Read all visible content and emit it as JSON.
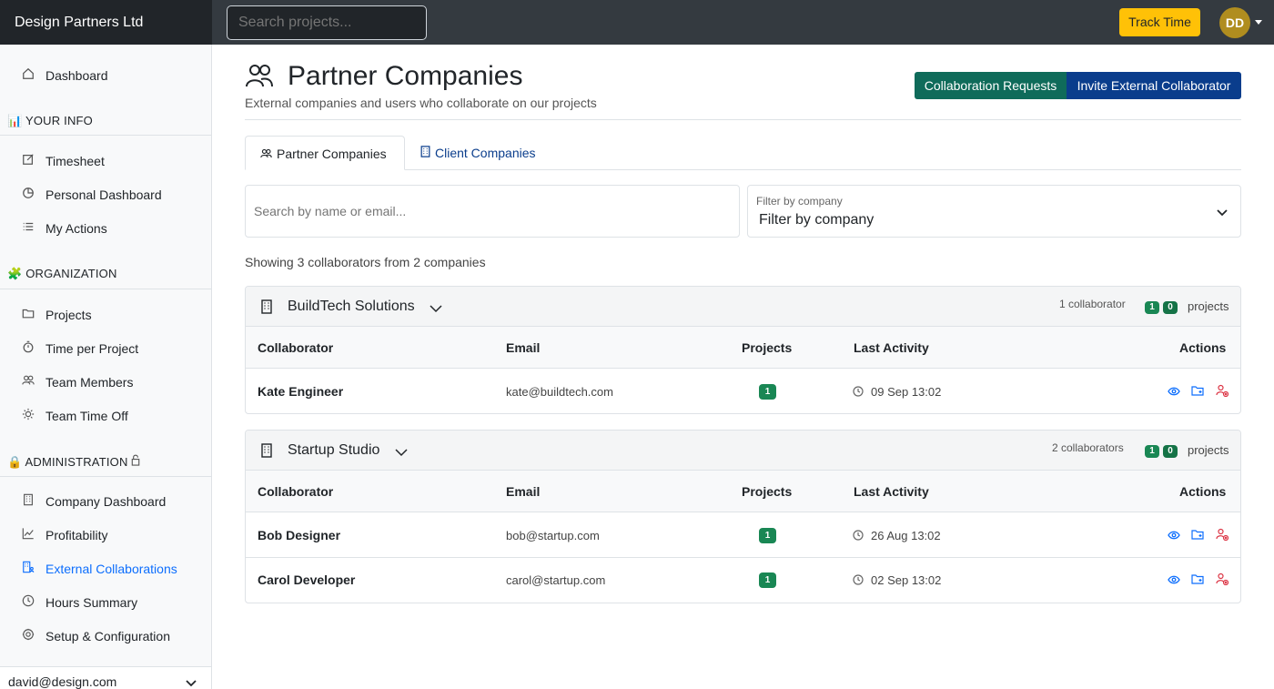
{
  "app": {
    "brand": "Design Partners Ltd",
    "search_placeholder": "Search projects...",
    "track_time": "Track Time",
    "avatar_initials": "DD"
  },
  "sidebar": {
    "dashboard": "Dashboard",
    "sections": {
      "your_info": "YOUR INFO",
      "organization": "ORGANIZATION",
      "administration": "ADMINISTRATION"
    },
    "your_info_items": [
      "Timesheet",
      "Personal Dashboard",
      "My Actions"
    ],
    "organization_items": [
      "Projects",
      "Time per Project",
      "Team Members",
      "Team Time Off"
    ],
    "administration_items": [
      "Company Dashboard",
      "Profitability",
      "External Collaborations",
      "Hours Summary",
      "Setup & Configuration"
    ],
    "active_item": "External Collaborations",
    "user_email": "david@design.com"
  },
  "page": {
    "title": "Partner Companies",
    "subtitle": "External companies and users who collaborate on our projects",
    "btn_collab_requests": "Collaboration Requests",
    "btn_invite": "Invite External Collaborator",
    "tabs": [
      "Partner Companies",
      "Client Companies"
    ],
    "active_tab": "Partner Companies",
    "search_placeholder": "Search by name or email...",
    "filter_label": "Filter by company",
    "filter_value": "Filter by company",
    "showing": "Showing 3 collaborators from 2 companies"
  },
  "table_headers": [
    "Collaborator",
    "Email",
    "Projects",
    "Last Activity",
    "Actions"
  ],
  "companies": [
    {
      "name": "BuildTech Solutions",
      "collaborators_count": "1 collaborator",
      "badge_a": "1",
      "badge_b": "0",
      "projects_label": "projects",
      "rows": [
        {
          "name": "Kate Engineer",
          "email": "kate@buildtech.com",
          "projects": "1",
          "last_activity": "09 Sep 13:02"
        }
      ]
    },
    {
      "name": "Startup Studio",
      "collaborators_count": "2 collaborators",
      "badge_a": "1",
      "badge_b": "0",
      "projects_label": "projects",
      "rows": [
        {
          "name": "Bob Designer",
          "email": "bob@startup.com",
          "projects": "1",
          "last_activity": "26 Aug 13:02"
        },
        {
          "name": "Carol Developer",
          "email": "carol@startup.com",
          "projects": "1",
          "last_activity": "02 Sep 13:02"
        }
      ]
    }
  ],
  "colors": {
    "accent": "#0d6efd",
    "success": "#198754",
    "collab_btn": "#0f6b5a",
    "invite_btn": "#0a3d8c",
    "track_btn": "#ffc107",
    "danger": "#dc3545"
  }
}
